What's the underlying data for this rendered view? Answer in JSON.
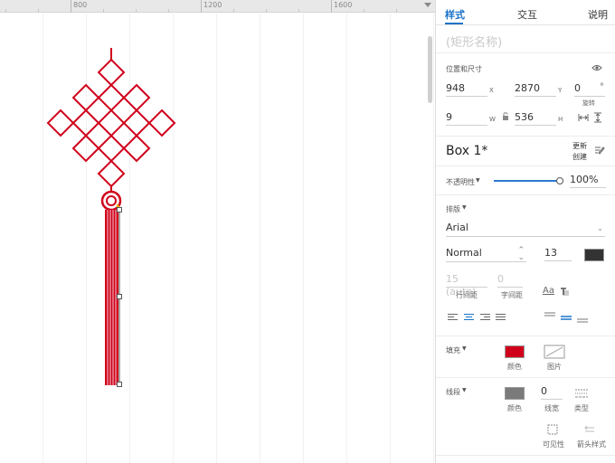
{
  "canvas": {
    "ruler_labels": [
      "800",
      "1200",
      "1600"
    ],
    "knot_color": "#d0021b",
    "selection_handle_color": "#555555"
  },
  "panel": {
    "tabs": [
      {
        "label": "样式",
        "active": true
      },
      {
        "label": "交互",
        "active": false
      },
      {
        "label": "说明",
        "active": false
      }
    ],
    "name_placeholder": "(矩形名称)",
    "position_size": {
      "section_label": "位置和尺寸",
      "x": "948",
      "x_unit": "X",
      "y": "2870",
      "y_unit": "Y",
      "rotation": "0",
      "rotation_unit": "°",
      "rotation_label": "旋转",
      "w": "9",
      "w_unit": "W",
      "h": "536",
      "h_unit": "H"
    },
    "style_name": "Box 1*",
    "update_label_line1": "更新",
    "update_label_line2": "创建",
    "opacity": {
      "label": "不透明性",
      "value": "100%",
      "level": 1.0
    },
    "typography": {
      "section_label": "排版",
      "font": "Arial",
      "weight": "Normal",
      "size": "13",
      "text_color": "#333333",
      "line_height_placeholder": "15 (auto)",
      "line_height_label": "行间距",
      "char_spacing_placeholder": "0",
      "char_spacing_label": "字间距"
    },
    "fill": {
      "section_label": "填充",
      "color": "#d0021b",
      "color_label": "颜色",
      "image_label": "图片"
    },
    "border": {
      "section_label": "线段",
      "color": "#7a7a7a",
      "color_label": "颜色",
      "width": "0",
      "width_label": "线宽",
      "type_label": "类型",
      "visibility_label": "可见性",
      "arrow_label": "箭头样式"
    }
  }
}
